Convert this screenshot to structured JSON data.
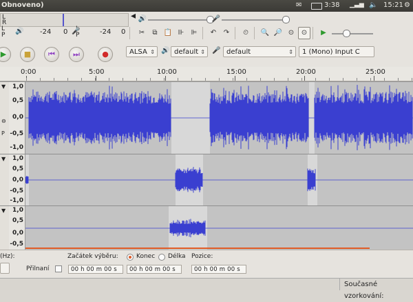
{
  "window": {
    "title": "Obnoveno)"
  },
  "tray": {
    "battery_time": "3:38",
    "clock": "15:21",
    "mail_icon": "envelope-icon",
    "battery_icon": "battery-icon",
    "network_icon": "signal-icon",
    "volume_icon": "speaker-icon",
    "power_icon": "gear-icon"
  },
  "meters": {
    "scale_left": "-24",
    "scale_zero": "0",
    "scale_right": "-24",
    "scale_zero2": "0",
    "L": "L",
    "R": "R",
    "P": "P"
  },
  "transport": {
    "play": "play-icon",
    "stop": "stop-icon",
    "skip_start": "skip-start-icon",
    "skip_end": "skip-end-icon",
    "record": "record-icon"
  },
  "devices": {
    "host": "ALSA",
    "output": "default",
    "input": "default",
    "channels": "1 (Mono) Input C"
  },
  "ruler": {
    "labels": [
      "0:00",
      "5:00",
      "10:00",
      "15:00",
      "20:00",
      "25:00"
    ]
  },
  "tracks": [
    {
      "scale": [
        "1,0",
        "0,5",
        "0,0",
        "-0,5",
        "-1,0"
      ]
    },
    {
      "scale": [
        "1,0",
        "0,5",
        "0,0",
        "-0,5",
        "-1,0"
      ]
    },
    {
      "scale": [
        "1,0",
        "0,5",
        "0,0",
        "-0,5"
      ]
    }
  ],
  "selection": {
    "rate_label": "(Hz):",
    "snap_label": "Přilnaní",
    "start_label": "Začátek výběru:",
    "end_label": "Konec",
    "length_label": "Délka",
    "position_label": "Pozice:",
    "time1": "00 h 00 m 00 s",
    "time2": "00 h 00 m 00 s",
    "time3": "00 h 00 m 00 s"
  },
  "status": {
    "current_rate": "Současné vzorkování:"
  },
  "colors": {
    "wave": "#3a3fd0",
    "selection_bg": "#c3c3c3",
    "ubuntu_orange": "#e05a24"
  }
}
